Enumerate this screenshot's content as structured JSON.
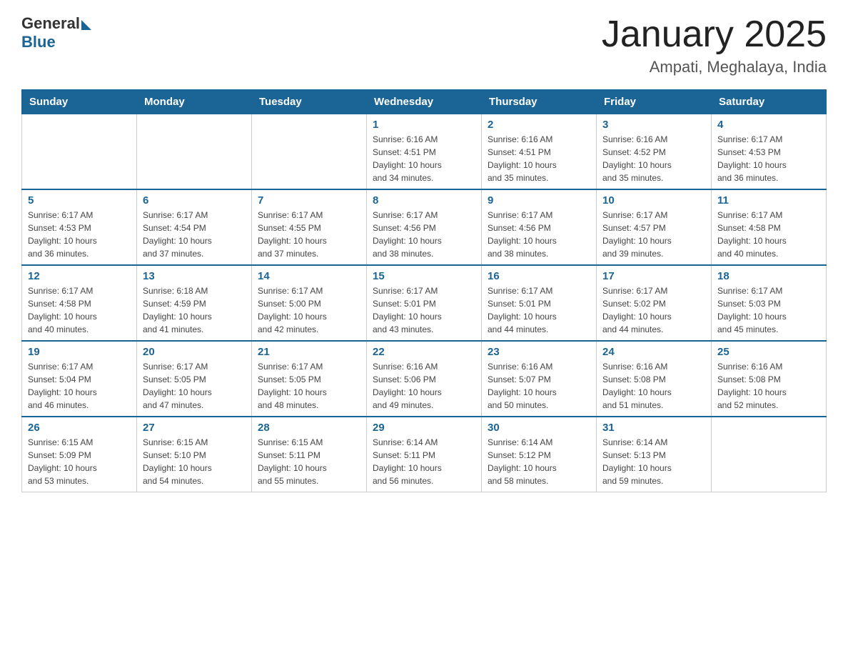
{
  "logo": {
    "text_general": "General",
    "text_blue": "Blue"
  },
  "title": "January 2025",
  "subtitle": "Ampati, Meghalaya, India",
  "headers": [
    "Sunday",
    "Monday",
    "Tuesday",
    "Wednesday",
    "Thursday",
    "Friday",
    "Saturday"
  ],
  "weeks": [
    [
      {
        "day": "",
        "info": ""
      },
      {
        "day": "",
        "info": ""
      },
      {
        "day": "",
        "info": ""
      },
      {
        "day": "1",
        "info": "Sunrise: 6:16 AM\nSunset: 4:51 PM\nDaylight: 10 hours\nand 34 minutes."
      },
      {
        "day": "2",
        "info": "Sunrise: 6:16 AM\nSunset: 4:51 PM\nDaylight: 10 hours\nand 35 minutes."
      },
      {
        "day": "3",
        "info": "Sunrise: 6:16 AM\nSunset: 4:52 PM\nDaylight: 10 hours\nand 35 minutes."
      },
      {
        "day": "4",
        "info": "Sunrise: 6:17 AM\nSunset: 4:53 PM\nDaylight: 10 hours\nand 36 minutes."
      }
    ],
    [
      {
        "day": "5",
        "info": "Sunrise: 6:17 AM\nSunset: 4:53 PM\nDaylight: 10 hours\nand 36 minutes."
      },
      {
        "day": "6",
        "info": "Sunrise: 6:17 AM\nSunset: 4:54 PM\nDaylight: 10 hours\nand 37 minutes."
      },
      {
        "day": "7",
        "info": "Sunrise: 6:17 AM\nSunset: 4:55 PM\nDaylight: 10 hours\nand 37 minutes."
      },
      {
        "day": "8",
        "info": "Sunrise: 6:17 AM\nSunset: 4:56 PM\nDaylight: 10 hours\nand 38 minutes."
      },
      {
        "day": "9",
        "info": "Sunrise: 6:17 AM\nSunset: 4:56 PM\nDaylight: 10 hours\nand 38 minutes."
      },
      {
        "day": "10",
        "info": "Sunrise: 6:17 AM\nSunset: 4:57 PM\nDaylight: 10 hours\nand 39 minutes."
      },
      {
        "day": "11",
        "info": "Sunrise: 6:17 AM\nSunset: 4:58 PM\nDaylight: 10 hours\nand 40 minutes."
      }
    ],
    [
      {
        "day": "12",
        "info": "Sunrise: 6:17 AM\nSunset: 4:58 PM\nDaylight: 10 hours\nand 40 minutes."
      },
      {
        "day": "13",
        "info": "Sunrise: 6:18 AM\nSunset: 4:59 PM\nDaylight: 10 hours\nand 41 minutes."
      },
      {
        "day": "14",
        "info": "Sunrise: 6:17 AM\nSunset: 5:00 PM\nDaylight: 10 hours\nand 42 minutes."
      },
      {
        "day": "15",
        "info": "Sunrise: 6:17 AM\nSunset: 5:01 PM\nDaylight: 10 hours\nand 43 minutes."
      },
      {
        "day": "16",
        "info": "Sunrise: 6:17 AM\nSunset: 5:01 PM\nDaylight: 10 hours\nand 44 minutes."
      },
      {
        "day": "17",
        "info": "Sunrise: 6:17 AM\nSunset: 5:02 PM\nDaylight: 10 hours\nand 44 minutes."
      },
      {
        "day": "18",
        "info": "Sunrise: 6:17 AM\nSunset: 5:03 PM\nDaylight: 10 hours\nand 45 minutes."
      }
    ],
    [
      {
        "day": "19",
        "info": "Sunrise: 6:17 AM\nSunset: 5:04 PM\nDaylight: 10 hours\nand 46 minutes."
      },
      {
        "day": "20",
        "info": "Sunrise: 6:17 AM\nSunset: 5:05 PM\nDaylight: 10 hours\nand 47 minutes."
      },
      {
        "day": "21",
        "info": "Sunrise: 6:17 AM\nSunset: 5:05 PM\nDaylight: 10 hours\nand 48 minutes."
      },
      {
        "day": "22",
        "info": "Sunrise: 6:16 AM\nSunset: 5:06 PM\nDaylight: 10 hours\nand 49 minutes."
      },
      {
        "day": "23",
        "info": "Sunrise: 6:16 AM\nSunset: 5:07 PM\nDaylight: 10 hours\nand 50 minutes."
      },
      {
        "day": "24",
        "info": "Sunrise: 6:16 AM\nSunset: 5:08 PM\nDaylight: 10 hours\nand 51 minutes."
      },
      {
        "day": "25",
        "info": "Sunrise: 6:16 AM\nSunset: 5:08 PM\nDaylight: 10 hours\nand 52 minutes."
      }
    ],
    [
      {
        "day": "26",
        "info": "Sunrise: 6:15 AM\nSunset: 5:09 PM\nDaylight: 10 hours\nand 53 minutes."
      },
      {
        "day": "27",
        "info": "Sunrise: 6:15 AM\nSunset: 5:10 PM\nDaylight: 10 hours\nand 54 minutes."
      },
      {
        "day": "28",
        "info": "Sunrise: 6:15 AM\nSunset: 5:11 PM\nDaylight: 10 hours\nand 55 minutes."
      },
      {
        "day": "29",
        "info": "Sunrise: 6:14 AM\nSunset: 5:11 PM\nDaylight: 10 hours\nand 56 minutes."
      },
      {
        "day": "30",
        "info": "Sunrise: 6:14 AM\nSunset: 5:12 PM\nDaylight: 10 hours\nand 58 minutes."
      },
      {
        "day": "31",
        "info": "Sunrise: 6:14 AM\nSunset: 5:13 PM\nDaylight: 10 hours\nand 59 minutes."
      },
      {
        "day": "",
        "info": ""
      }
    ]
  ]
}
